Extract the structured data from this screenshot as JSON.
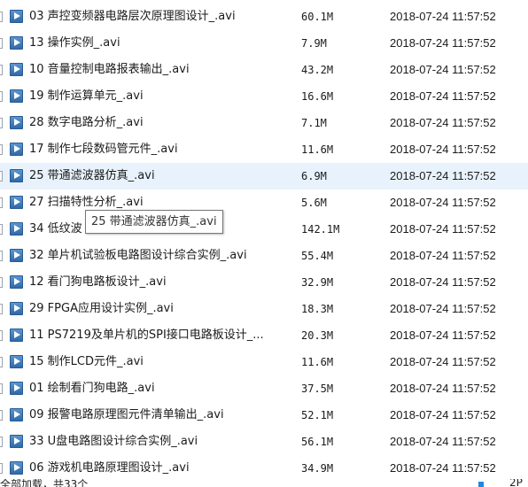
{
  "files": [
    {
      "name": "03  声控变频器电路层次原理图设计_.avi",
      "size": "60.1M",
      "date": "2018-07-24 11:57:52"
    },
    {
      "name": "13  操作实例_.avi",
      "size": "7.9M",
      "date": "2018-07-24 11:57:52"
    },
    {
      "name": "10  音量控制电路报表输出_.avi",
      "size": "43.2M",
      "date": "2018-07-24 11:57:52"
    },
    {
      "name": "19  制作运算单元_.avi",
      "size": "16.6M",
      "date": "2018-07-24 11:57:52"
    },
    {
      "name": "28  数字电路分析_.avi",
      "size": "7.1M",
      "date": "2018-07-24 11:57:52"
    },
    {
      "name": "17  制作七段数码管元件_.avi",
      "size": "11.6M",
      "date": "2018-07-24 11:57:52"
    },
    {
      "name": "25  带通滤波器仿真_.avi",
      "size": "6.9M",
      "date": "2018-07-24 11:57:52"
    },
    {
      "name": "27  扫描特性分析_.avi",
      "size": "5.6M",
      "date": "2018-07-24 11:57:52"
    },
    {
      "name": "34 低纹波",
      "size": "142.1M",
      "date": "2018-07-24 11:57:52"
    },
    {
      "name": "32 单片机试验板电路图设计综合实例_.avi",
      "size": "55.4M",
      "date": "2018-07-24 11:57:52"
    },
    {
      "name": "12  看门狗电路板设计_.avi",
      "size": "32.9M",
      "date": "2018-07-24 11:57:52"
    },
    {
      "name": "29  FPGA应用设计实例_.avi",
      "size": "18.3M",
      "date": "2018-07-24 11:57:52"
    },
    {
      "name": "11 PS7219及单片机的SPI接口电路板设计_...",
      "size": "20.3M",
      "date": "2018-07-24 11:57:52"
    },
    {
      "name": "15  制作LCD元件_.avi",
      "size": "11.6M",
      "date": "2018-07-24 11:57:52"
    },
    {
      "name": "01  绘制看门狗电路_.avi",
      "size": "37.5M",
      "date": "2018-07-24 11:57:52"
    },
    {
      "name": "09  报警电路原理图元件清单输出_.avi",
      "size": "52.1M",
      "date": "2018-07-24 11:57:52"
    },
    {
      "name": "33 U盘电路图设计综合实例_.avi",
      "size": "56.1M",
      "date": "2018-07-24 11:57:52"
    },
    {
      "name": "06  游戏机电路原理图设计_.avi",
      "size": "34.9M",
      "date": "2018-07-24 11:57:52"
    }
  ],
  "hover_index": 6,
  "tooltip": "25  带通滤波器仿真_.avi",
  "status": {
    "text": "全部加载，共33个",
    "right_text": "2P"
  },
  "colors": {
    "hover_row": "#e8f2fc",
    "file_icon": "#2f69a8"
  }
}
